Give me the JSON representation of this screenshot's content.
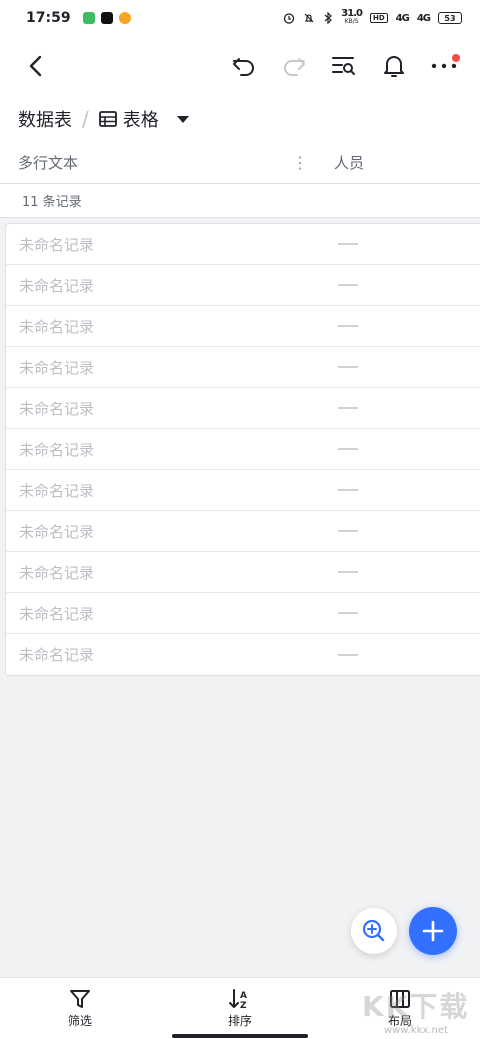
{
  "status": {
    "time": "17:59",
    "net_speed": "31.0",
    "net_unit": "KB/S",
    "hd": "HD",
    "signal1": "4G",
    "signal2": "4G",
    "battery": "53",
    "app_colors": [
      "#3dbd5f",
      "#111111",
      "#f5a623"
    ]
  },
  "nav": {
    "back": "back-icon",
    "undo": "undo-icon",
    "redo": "redo-icon",
    "search": "search-list-icon",
    "bell": "bell-icon",
    "more": "more-icon"
  },
  "breadcrumb": {
    "table": "数据表",
    "separator": "/",
    "view": "表格"
  },
  "columns": {
    "text": "多行文本",
    "menu": "⋮",
    "person": "人员"
  },
  "count": "11 条记录",
  "records": [
    {
      "title": "未命名记录"
    },
    {
      "title": "未命名记录"
    },
    {
      "title": "未命名记录"
    },
    {
      "title": "未命名记录"
    },
    {
      "title": "未命名记录"
    },
    {
      "title": "未命名记录"
    },
    {
      "title": "未命名记录"
    },
    {
      "title": "未命名记录"
    },
    {
      "title": "未命名记录"
    },
    {
      "title": "未命名记录"
    },
    {
      "title": "未命名记录"
    }
  ],
  "toolbar": {
    "filter": "筛选",
    "sort": "排序",
    "layout": "布局"
  },
  "watermark": {
    "text": "KK下载",
    "url": "www.kkx.net"
  },
  "colors": {
    "accent": "#3370ff",
    "badge": "#f54a45"
  }
}
